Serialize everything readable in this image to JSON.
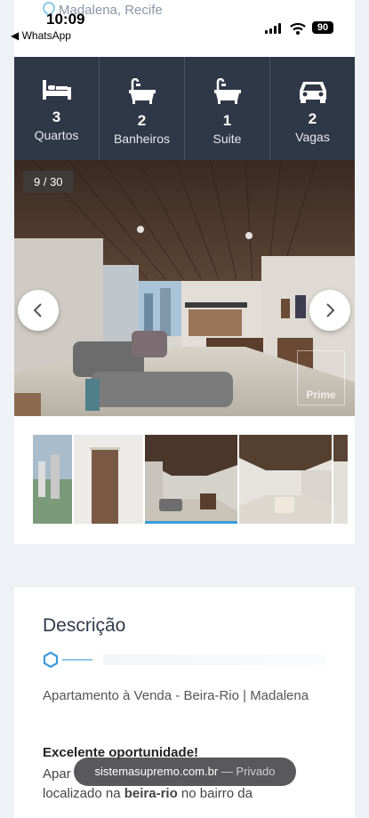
{
  "status_bar": {
    "time": "10:09",
    "back_app": "◀ WhatsApp",
    "battery": "90"
  },
  "listing": {
    "location_behind": "Madalena, Recife",
    "features": [
      {
        "icon": "bed-icon",
        "value": "3",
        "label": "Quartos"
      },
      {
        "icon": "bathtub-icon",
        "value": "2",
        "label": "Banheiros"
      },
      {
        "icon": "bathtub-icon",
        "value": "1",
        "label": "Suite"
      },
      {
        "icon": "car-icon",
        "value": "2",
        "label": "Vagas"
      }
    ],
    "gallery": {
      "counter": "9 / 30",
      "watermark": "Prime",
      "active_thumb_index": 2
    }
  },
  "description": {
    "title": "Descrição",
    "text": "Apartamento à Venda - Beira-Rio | Madalena",
    "subtitle": "Excelente oportunidade!",
    "body_start": "Apar",
    "body_line2_prefix": "localizado na ",
    "body_bold": "beira-rio",
    "body_line2_suffix": " no bairro da"
  },
  "browser": {
    "url": "sistemasupremo.com.br",
    "mode": "— Privado"
  },
  "colors": {
    "feature_bar": "#2f3847",
    "accent": "#3a9bdc",
    "page_bg": "#eef1f5"
  }
}
